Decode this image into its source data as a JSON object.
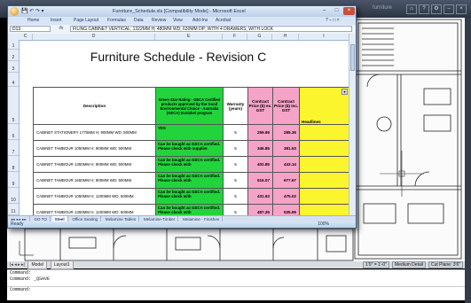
{
  "cad": {
    "title": "furniture",
    "layout_tabs": [
      "Model",
      "Layout1"
    ],
    "status_scale": "1'0\" = 1'-0\"",
    "status_detail": "Medium Detail",
    "status_cut": "Cut Plane: 3'6\"",
    "command_lines": [
      "Command:",
      "Command:  _QSAVE",
      "Command:"
    ]
  },
  "excel": {
    "title": "Furniture_Schedule.xls  [Compatibility Mode] - Microsoft Excel",
    "ribbon_tabs": [
      "Home",
      "Insert",
      "Page Layout",
      "Formulas",
      "Data",
      "Review",
      "View",
      "Add-Ins",
      "Acrobat"
    ],
    "name_box": "D13",
    "formula": "FILING CABINET VERTICAL; 1322MM H; 480MM WD; 630MM DP; WITH 4 DRAWERS; WITH LOCK",
    "columns": [
      "C",
      "D",
      "E",
      "F",
      "G",
      "H",
      "I"
    ],
    "rows": [
      "1",
      "2",
      "3",
      "4",
      "5",
      "6",
      "7",
      "8",
      "9",
      "10",
      "11"
    ],
    "sheet_title": "Furniture Schedule - Revision C",
    "headers": {
      "description": "Description",
      "green_star": "Green Star Rating - GECA Certified products approved by the Good Environmental Choice - Australia (GECA) Ecolabel program",
      "warranty": "Warranty (years)",
      "price_ex": "Contract Price ($) ex. GST",
      "price_inc": "Contract Price ($) inc. GST",
      "headlines": "Headlines"
    },
    "table_rows": [
      {
        "desc": "CABINET STATIONERY  1775MM H; 900MM WD; 500MM",
        "green": "YES",
        "warranty": "5",
        "ex": "259.69",
        "inc": "285.36"
      },
      {
        "desc": "CABINET TAMBOUR 1050MM H; 900MM WD; 500MM",
        "green": "Can be bought as GECA certified. Please check with supplier.",
        "warranty": "5",
        "ex": "346.85",
        "inc": "381.53"
      },
      {
        "desc": "CABINET TAMBOUR 1350MM H; 900MM WD; 500MM",
        "green": "Can be bought as GECA certified. Please check with",
        "warranty": "5",
        "ex": "402.85",
        "inc": "443.14"
      },
      {
        "desc": "CABINET TAMBOUR 1650MM H; 900MM WD; 500MM",
        "green": "Can be bought as GECA certified. Please check with",
        "warranty": "5",
        "ex": "616.07",
        "inc": "677.67"
      },
      {
        "desc": "CABINET TAMBOUR 1050MM H; 1200MM WD; 500MM",
        "green": "Can be bought as GECA certified. Please check with",
        "warranty": "5",
        "ex": "431.63",
        "inc": "475.02"
      },
      {
        "desc": "CABINET TAMBOUR 1350MM H; 1200MM WD; 500MM",
        "green": "Can be bought as GECA certified. Please check with",
        "warranty": "5",
        "ex": "487.26",
        "inc": "535.99"
      }
    ],
    "sheet_tabs": [
      "GO TO",
      "Steel",
      "Office Seating",
      "Melamine Tables",
      "Melamine-Timber",
      "Melamine - Finishes"
    ],
    "active_sheet": "Steel",
    "status": "Ready",
    "zoom": "100%"
  }
}
